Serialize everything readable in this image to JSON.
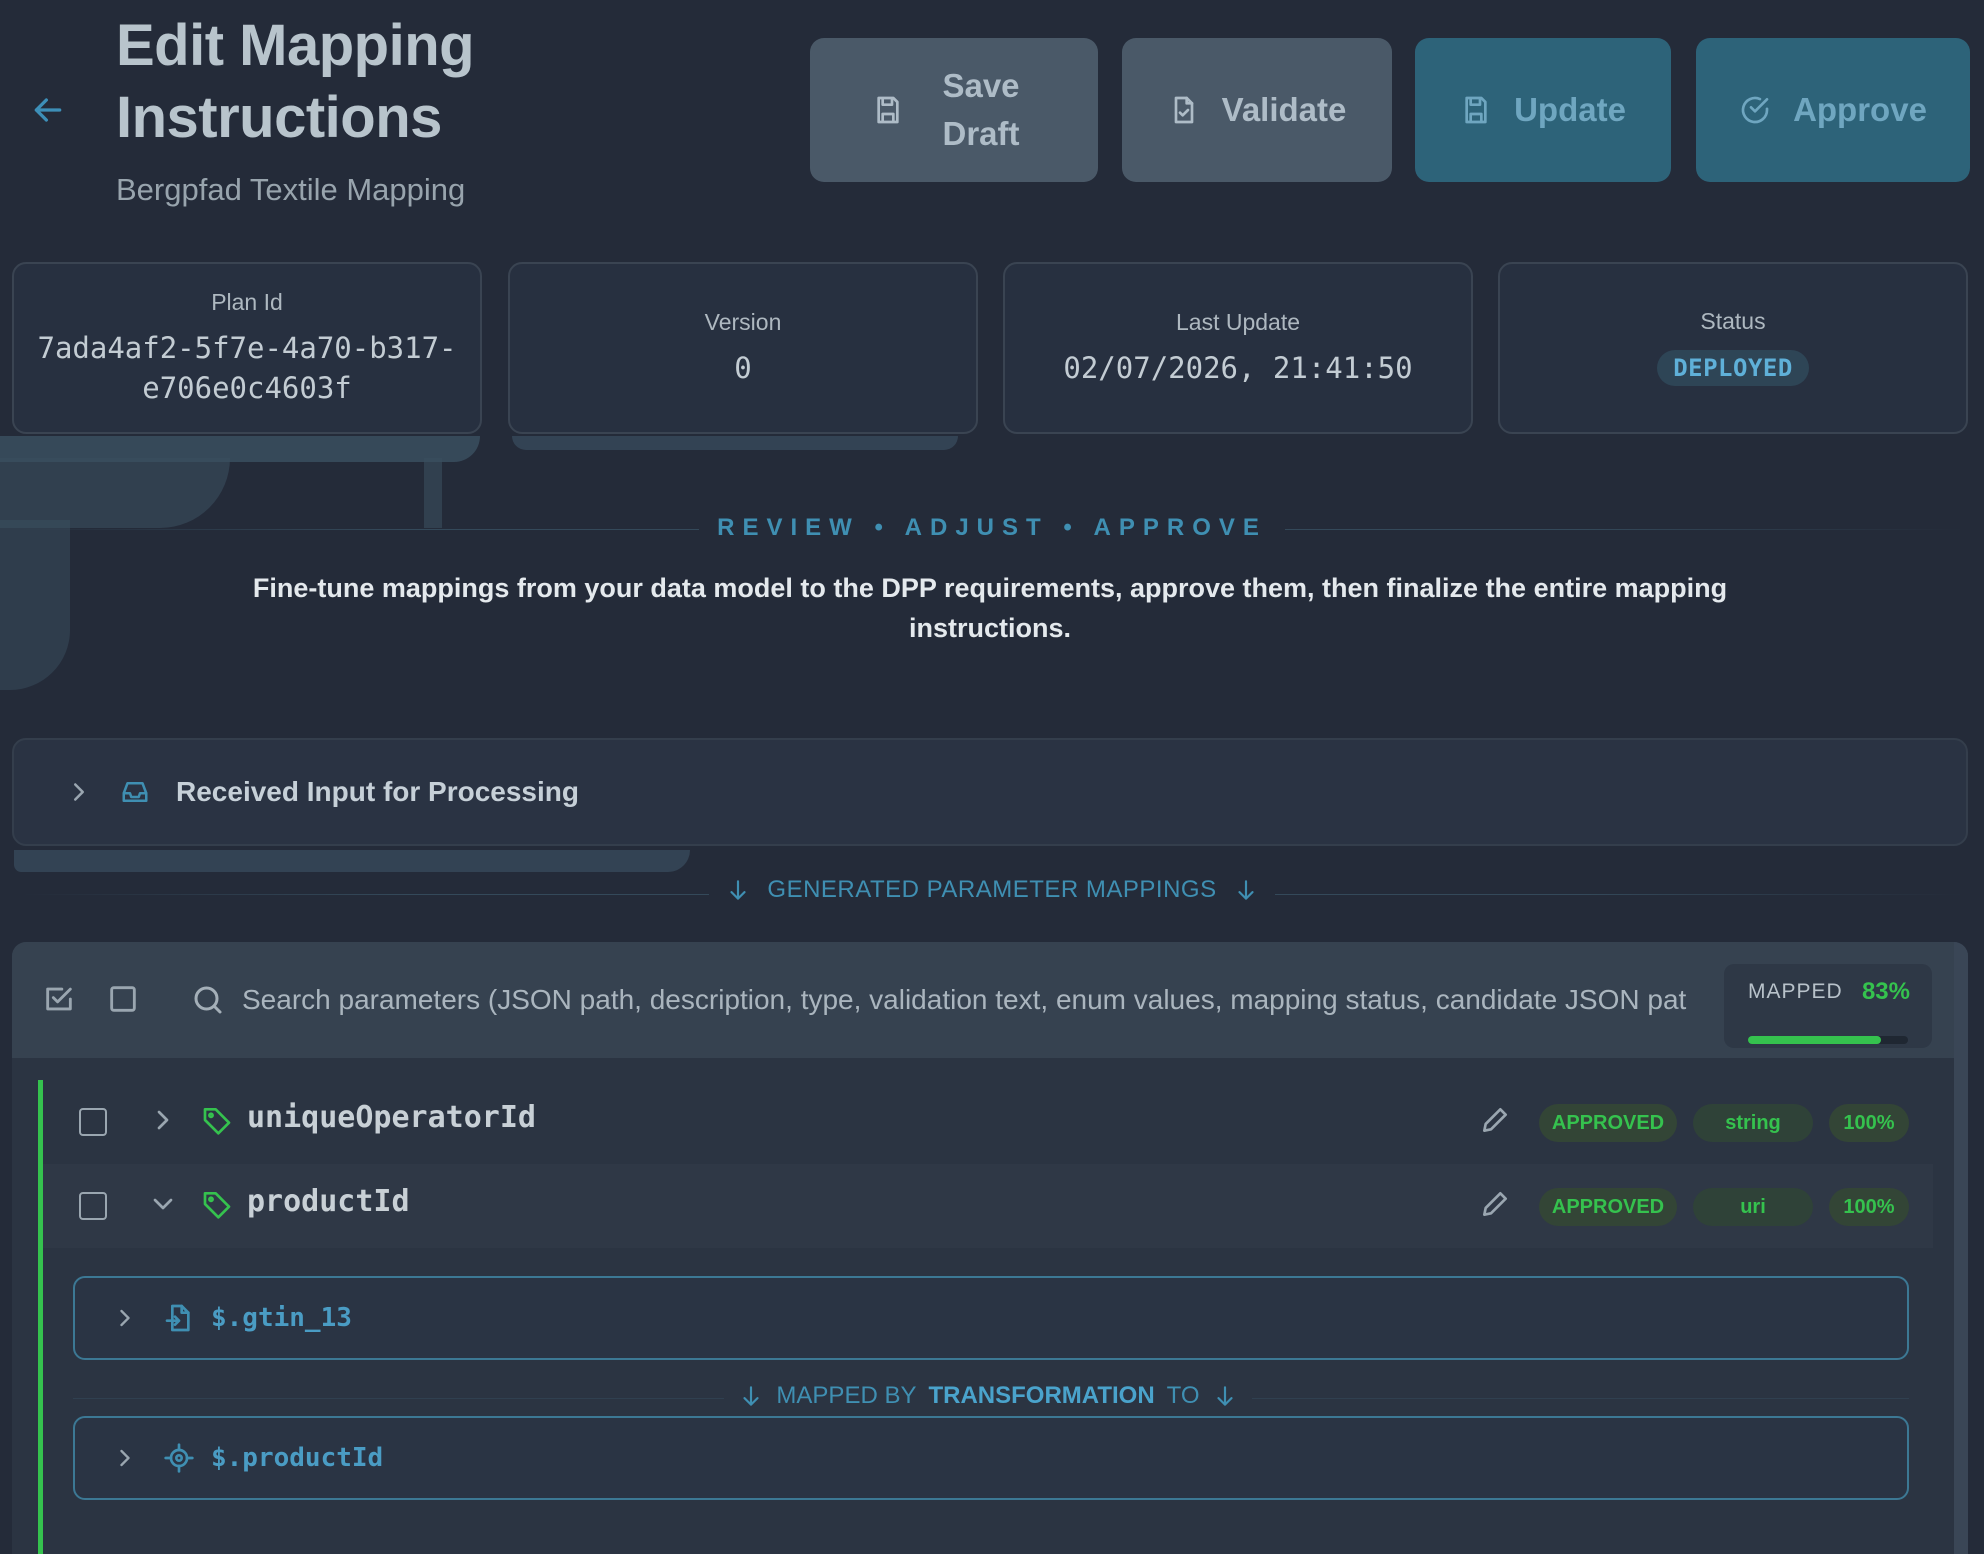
{
  "header": {
    "title_line1": "Edit Mapping",
    "title_line2": "Instructions",
    "subtitle": "Bergpfad Textile Mapping",
    "buttons": {
      "save_draft_line1": "Save",
      "save_draft_line2": "Draft",
      "validate": "Validate",
      "update": "Update",
      "approve": "Approve"
    }
  },
  "info": {
    "plan_id_label": "Plan Id",
    "plan_id_line1": "7ada4af2-5f7e-4a70-b317-",
    "plan_id_line2": "e706e0c4603f",
    "version_label": "Version",
    "version_value": "0",
    "last_update_label": "Last Update",
    "last_update_value": "02/07/2026, 21:41:50",
    "status_label": "Status",
    "status_value": "DEPLOYED"
  },
  "section": {
    "eyebrow": "REVIEW • ADJUST • APPROVE",
    "intro": "Fine-tune mappings from your data model to the DPP requirements, approve them, then finalize the entire mapping instructions."
  },
  "received_input": {
    "label": "Received Input for Processing"
  },
  "generated": {
    "heading": "GENERATED PARAMETER MAPPINGS"
  },
  "toolbar": {
    "search_placeholder": "Search parameters (JSON path, description, type, validation text, enum values, mapping status, candidate JSON pat",
    "mapped_label": "MAPPED",
    "mapped_percent_text": "83%",
    "mapped_fraction": 0.83
  },
  "parameters": [
    {
      "name": "uniqueOperatorId",
      "status": "APPROVED",
      "type": "string",
      "confidence": "100%",
      "expanded": false
    },
    {
      "name": "productId",
      "status": "APPROVED",
      "type": "uri",
      "confidence": "100%",
      "expanded": true
    }
  ],
  "mapping_detail": {
    "source": "$.gtin_13",
    "mapped_by_prefix": "MAPPED BY",
    "mapped_by_method": "TRANSFORMATION",
    "mapped_by_suffix": "TO",
    "target": "$.productId"
  },
  "colors": {
    "background": "#242b39",
    "accent_blue": "#3f8fb2",
    "accent_green": "#35c24e",
    "button_teal": "#2d6379",
    "button_grey": "#4a5968"
  },
  "icons": [
    "arrow-left-icon",
    "save-icon",
    "file-check-icon",
    "circle-check-icon",
    "chevron-right-icon",
    "chevron-down-icon",
    "inbox-icon",
    "arrow-down-icon",
    "checkbox-icon",
    "search-icon",
    "tag-icon",
    "pencil-icon",
    "file-import-icon",
    "target-icon"
  ]
}
